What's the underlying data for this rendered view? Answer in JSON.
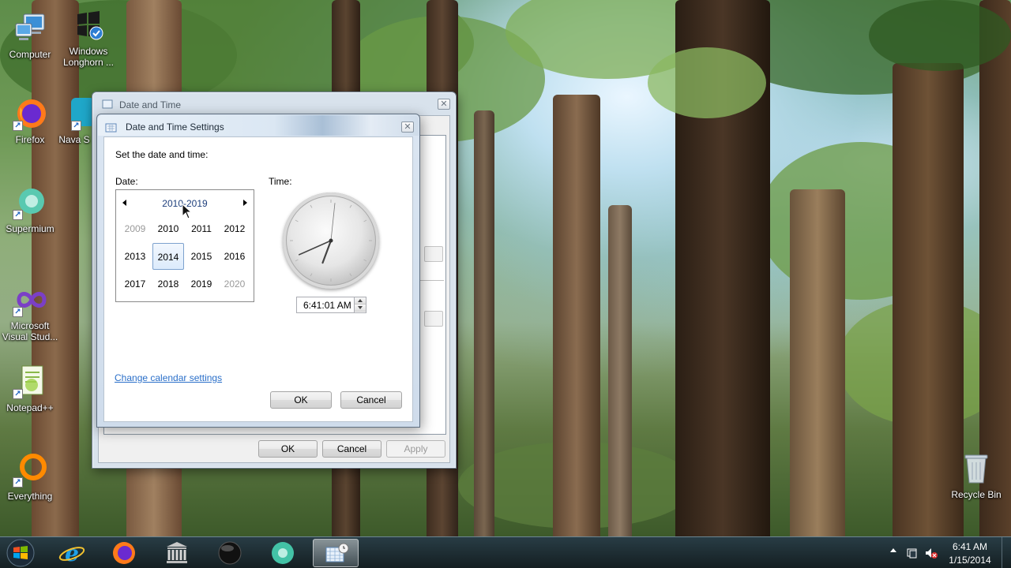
{
  "desktop": {
    "icons": [
      {
        "label": "Computer",
        "icon": "computer-icon"
      },
      {
        "label": "Windows Longhorn ...",
        "icon": "windows-logo-icon"
      },
      {
        "label": "Firefox",
        "icon": "firefox-icon"
      },
      {
        "label": "Nava S",
        "icon": "app-icon"
      },
      {
        "label": "Supermium",
        "icon": "supermium-icon"
      },
      {
        "label": "Microsoft Visual Stud...",
        "icon": "visual-studio-icon"
      },
      {
        "label": "Notepad++",
        "icon": "notepad-plus-plus-icon"
      },
      {
        "label": "Everything",
        "icon": "everything-search-icon"
      },
      {
        "label": "Recycle Bin",
        "icon": "recycle-bin-icon"
      }
    ]
  },
  "outer_dialog": {
    "title": "Date and Time",
    "buttons": {
      "ok": "OK",
      "cancel": "Cancel",
      "apply": "Apply"
    }
  },
  "inner_dialog": {
    "title": "Date and Time Settings",
    "instruction": "Set the date and time:",
    "date_label": "Date:",
    "time_label": "Time:",
    "calendar": {
      "header": "2010-2019",
      "years": [
        "2009",
        "2010",
        "2011",
        "2012",
        "2013",
        "2014",
        "2015",
        "2016",
        "2017",
        "2018",
        "2019",
        "2020"
      ],
      "selected_year": "2014",
      "dim_years": [
        "2009",
        "2020"
      ]
    },
    "clock": {
      "hours": 6,
      "minutes": 41,
      "seconds": 1
    },
    "time_value": "6:41:01 AM",
    "change_calendar_link": "Change calendar settings",
    "buttons": {
      "ok": "OK",
      "cancel": "Cancel"
    }
  },
  "taskbar": {
    "items": [
      "start-orb",
      "internet-explorer",
      "firefox",
      "library",
      "media-disc",
      "supermium",
      "date-time-settings"
    ],
    "active_item": "date-time-settings",
    "clock_time": "6:41 AM",
    "clock_date": "1/15/2014"
  }
}
